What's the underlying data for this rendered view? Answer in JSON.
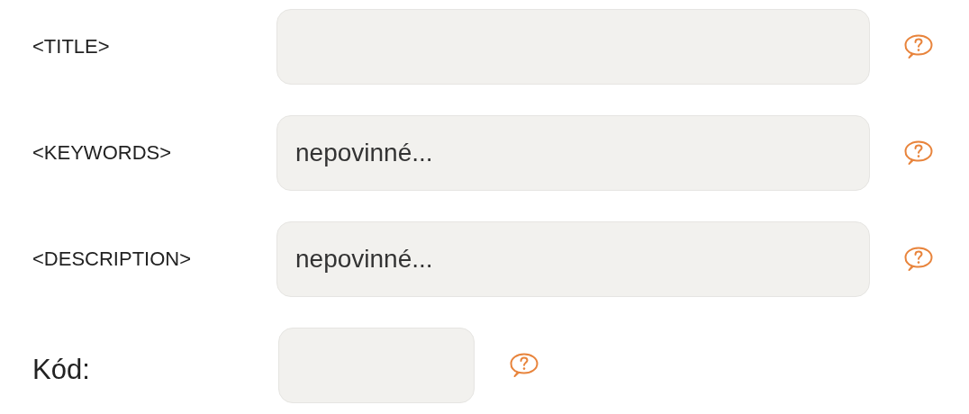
{
  "fields": [
    {
      "kind": "meta",
      "label": "<TITLE>"
    },
    {
      "kind": "meta",
      "label": "<KEYWORDS>",
      "placeholder": "nepovinné..."
    },
    {
      "kind": "meta",
      "label": "<DESCRIPTION>",
      "placeholder": "nepovinné..."
    },
    {
      "kind": "code",
      "label": "Kód:"
    }
  ]
}
